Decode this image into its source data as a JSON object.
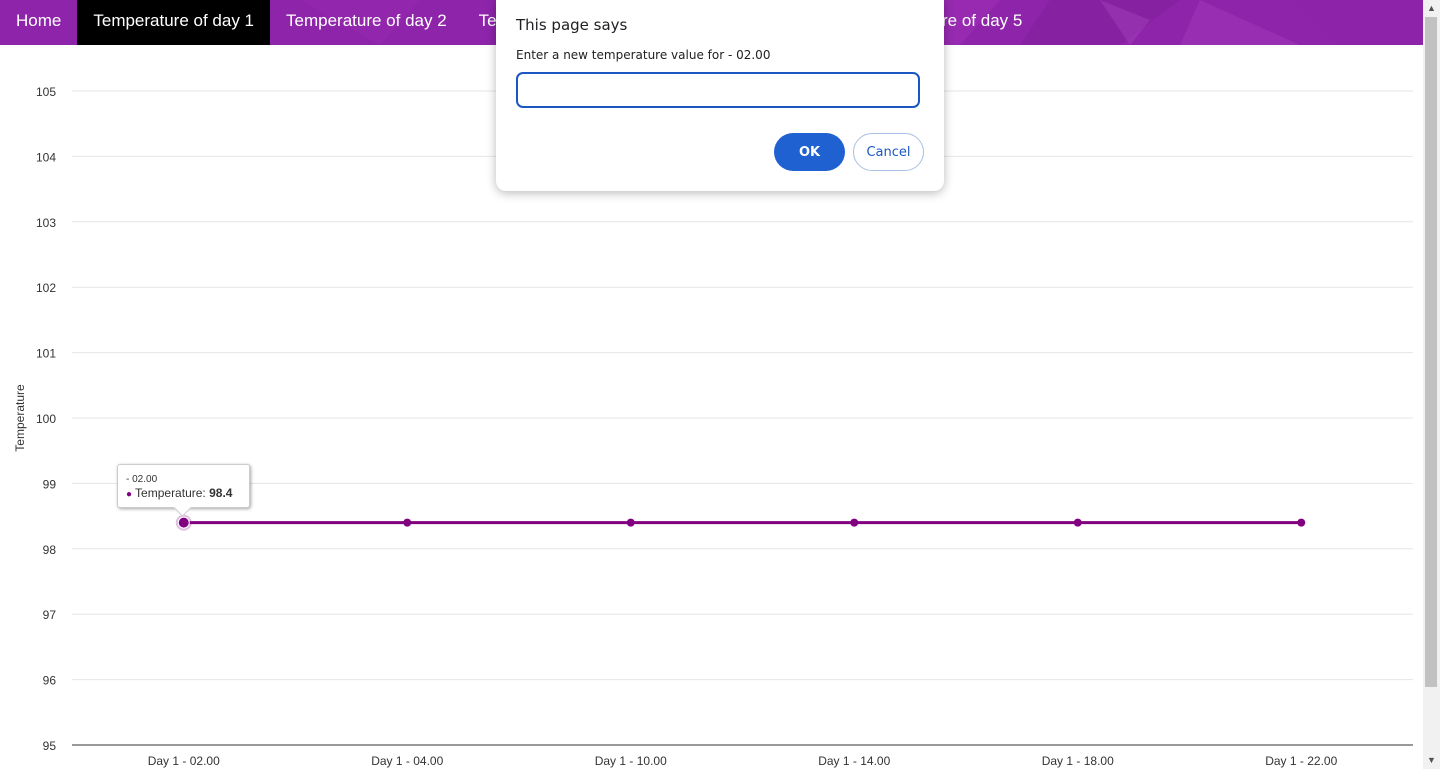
{
  "nav": {
    "tabs": [
      {
        "label": "Home",
        "active": false
      },
      {
        "label": "Temperature of day 1",
        "active": true
      },
      {
        "label": "Temperature of day 2",
        "active": false
      },
      {
        "label": "Te",
        "active": false
      },
      {
        "label": "re of day 5",
        "active": false
      }
    ],
    "colors": {
      "bar": "#8e24aa",
      "active_tab": "#000000",
      "text": "#ffffff"
    }
  },
  "dialog": {
    "title": "This page says",
    "message": "Enter a new temperature value for - 02.00",
    "input_value": "",
    "ok_label": "OK",
    "cancel_label": "Cancel",
    "colors": {
      "ok": "#1f61d0",
      "accent": "#1a57c3"
    }
  },
  "tooltip": {
    "header": "- 02.00",
    "series_label": "Temperature: ",
    "value": "98.4"
  },
  "chart_data": {
    "type": "line",
    "categories": [
      "Day 1 - 02.00",
      "Day 1 - 04.00",
      "Day 1 - 10.00",
      "Day 1 - 14.00",
      "Day 1 - 18.00",
      "Day 1 - 22.00"
    ],
    "series": [
      {
        "name": "Temperature",
        "values": [
          98.4,
          98.4,
          98.4,
          98.4,
          98.4,
          98.4
        ],
        "color": "#800080"
      }
    ],
    "ylabel": "Temperature",
    "xlabel": "",
    "title": "",
    "ylim": [
      95,
      105
    ],
    "yticks": [
      95,
      96,
      97,
      98,
      99,
      100,
      101,
      102,
      103,
      104,
      105
    ],
    "grid": true,
    "highlighted_index": 0
  }
}
